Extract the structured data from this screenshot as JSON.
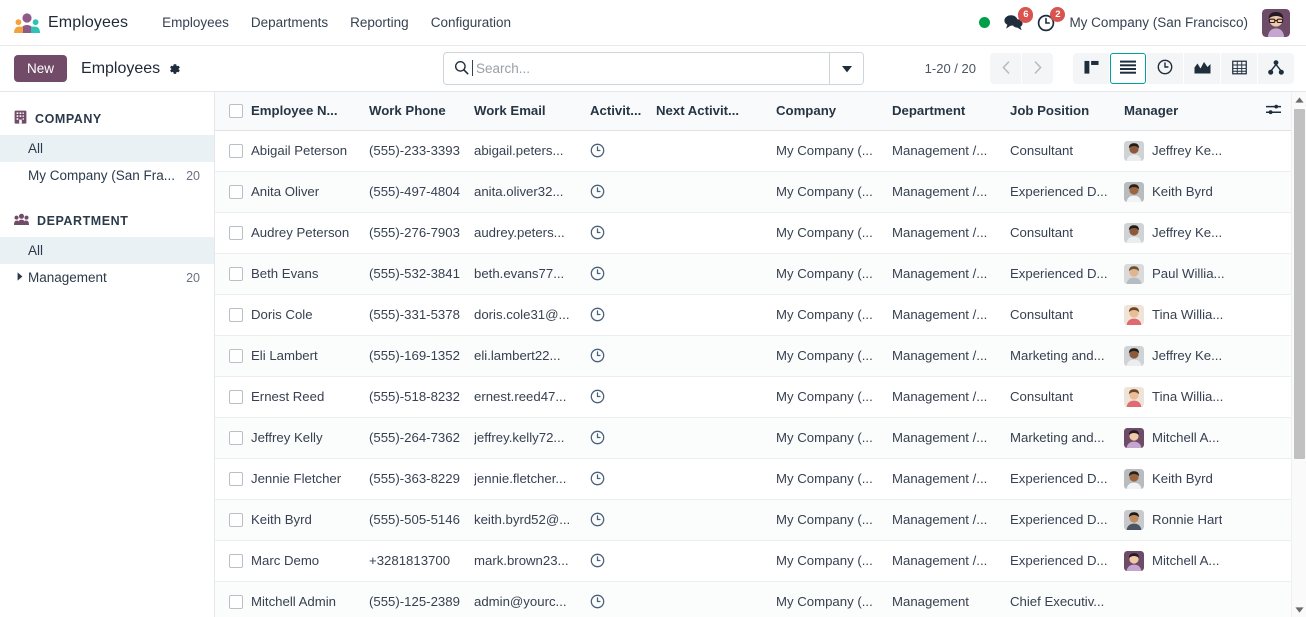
{
  "navbar": {
    "brand": "Employees",
    "brand_logo_icon": "employees-app-icon",
    "menu": [
      {
        "label": "Employees"
      },
      {
        "label": "Departments"
      },
      {
        "label": "Reporting"
      },
      {
        "label": "Configuration"
      }
    ],
    "presence_icon": "presence-dot-online",
    "presence_color": "#00A04A",
    "messages": {
      "icon": "chat-bubble-icon",
      "count": "6"
    },
    "activities": {
      "icon": "clock-icon",
      "count": "2"
    },
    "badge_color": "#D9534F",
    "company": "My Company (San Francisco)",
    "avatar_icon": "user-avatar"
  },
  "control": {
    "new_label": "New",
    "breadcrumb": "Employees",
    "gear_icon": "gear-icon",
    "accent_color": "#714B67",
    "search": {
      "icon": "search-icon",
      "placeholder": "Search...",
      "value": "",
      "toggle_icon": "chevron-down-icon"
    },
    "pager": {
      "range": "1-20 / 20",
      "prev_icon": "chevron-left-icon",
      "next_icon": "chevron-right-icon"
    },
    "views": [
      {
        "name": "kanban",
        "icon": "kanban-icon",
        "active": false
      },
      {
        "name": "list",
        "icon": "list-icon",
        "active": true
      },
      {
        "name": "activity",
        "icon": "activity-clock-icon",
        "active": false
      },
      {
        "name": "graph",
        "icon": "graph-icon",
        "active": false
      },
      {
        "name": "pivot",
        "icon": "pivot-table-icon",
        "active": false
      },
      {
        "name": "org-chart",
        "icon": "org-chart-icon",
        "active": false
      }
    ],
    "active_view_color": "#00A09D"
  },
  "sidebar": {
    "sections": [
      {
        "title": "COMPANY",
        "icon": "building-icon",
        "items": [
          {
            "label": "All",
            "count": "",
            "selected": true,
            "caret": false
          },
          {
            "label": "My Company (San Fra...",
            "count": "20",
            "selected": false,
            "caret": false
          }
        ]
      },
      {
        "title": "DEPARTMENT",
        "icon": "people-group-icon",
        "items": [
          {
            "label": "All",
            "count": "",
            "selected": true,
            "caret": false
          },
          {
            "label": "Management",
            "count": "20",
            "selected": false,
            "caret": true
          }
        ]
      }
    ]
  },
  "table": {
    "select_all_icon": "checkbox-unchecked",
    "optional_columns_icon": "column-options-icon",
    "columns": [
      "Employee N...",
      "Work Phone",
      "Work Email",
      "Activit...",
      "Next Activit...",
      "Company",
      "Department",
      "Job Position",
      "Manager"
    ],
    "rows": [
      {
        "name": "Abigail Peterson",
        "phone": "(555)-233-3393",
        "email": "abigail.peters...",
        "activity_icon": "clock-icon",
        "next_activity": "",
        "company": "My Company (...",
        "department": "Management /...",
        "job": "Consultant",
        "manager": "Jeffrey Ke...",
        "manager_avatar": "avatar-jeffrey"
      },
      {
        "name": "Anita Oliver",
        "phone": "(555)-497-4804",
        "email": "anita.oliver32...",
        "activity_icon": "clock-icon",
        "next_activity": "",
        "company": "My Company (...",
        "department": "Management /...",
        "job": "Experienced D...",
        "manager": "Keith Byrd",
        "manager_avatar": "avatar-keith"
      },
      {
        "name": "Audrey Peterson",
        "phone": "(555)-276-7903",
        "email": "audrey.peters...",
        "activity_icon": "clock-icon",
        "next_activity": "",
        "company": "My Company (...",
        "department": "Management /...",
        "job": "Consultant",
        "manager": "Jeffrey Ke...",
        "manager_avatar": "avatar-jeffrey"
      },
      {
        "name": "Beth Evans",
        "phone": "(555)-532-3841",
        "email": "beth.evans77...",
        "activity_icon": "clock-icon",
        "next_activity": "",
        "company": "My Company (...",
        "department": "Management /...",
        "job": "Experienced D...",
        "manager": "Paul Willia...",
        "manager_avatar": "avatar-paul"
      },
      {
        "name": "Doris Cole",
        "phone": "(555)-331-5378",
        "email": "doris.cole31@...",
        "activity_icon": "clock-icon",
        "next_activity": "",
        "company": "My Company (...",
        "department": "Management /...",
        "job": "Consultant",
        "manager": "Tina Willia...",
        "manager_avatar": "avatar-tina"
      },
      {
        "name": "Eli Lambert",
        "phone": "(555)-169-1352",
        "email": "eli.lambert22...",
        "activity_icon": "clock-icon",
        "next_activity": "",
        "company": "My Company (...",
        "department": "Management /...",
        "job": "Marketing and...",
        "manager": "Jeffrey Ke...",
        "manager_avatar": "avatar-jeffrey"
      },
      {
        "name": "Ernest Reed",
        "phone": "(555)-518-8232",
        "email": "ernest.reed47...",
        "activity_icon": "clock-icon",
        "next_activity": "",
        "company": "My Company (...",
        "department": "Management /...",
        "job": "Consultant",
        "manager": "Tina Willia...",
        "manager_avatar": "avatar-tina"
      },
      {
        "name": "Jeffrey Kelly",
        "phone": "(555)-264-7362",
        "email": "jeffrey.kelly72...",
        "activity_icon": "clock-icon",
        "next_activity": "",
        "company": "My Company (...",
        "department": "Management /...",
        "job": "Marketing and...",
        "manager": "Mitchell A...",
        "manager_avatar": "avatar-mitchell"
      },
      {
        "name": "Jennie Fletcher",
        "phone": "(555)-363-8229",
        "email": "jennie.fletcher...",
        "activity_icon": "clock-icon",
        "next_activity": "",
        "company": "My Company (...",
        "department": "Management /...",
        "job": "Experienced D...",
        "manager": "Keith Byrd",
        "manager_avatar": "avatar-keith"
      },
      {
        "name": "Keith Byrd",
        "phone": "(555)-505-5146",
        "email": "keith.byrd52@...",
        "activity_icon": "clock-icon",
        "next_activity": "",
        "company": "My Company (...",
        "department": "Management /...",
        "job": "Experienced D...",
        "manager": "Ronnie Hart",
        "manager_avatar": "avatar-ronnie"
      },
      {
        "name": "Marc Demo",
        "phone": "+3281813700",
        "email": "mark.brown23...",
        "activity_icon": "clock-icon",
        "next_activity": "",
        "company": "My Company (...",
        "department": "Management /...",
        "job": "Experienced D...",
        "manager": "Mitchell A...",
        "manager_avatar": "avatar-mitchell"
      },
      {
        "name": "Mitchell Admin",
        "phone": "(555)-125-2389",
        "email": "admin@yourc...",
        "activity_icon": "clock-icon",
        "next_activity": "",
        "company": "My Company (...",
        "department": "Management",
        "job": "Chief Executiv...",
        "manager": "",
        "manager_avatar": ""
      }
    ]
  },
  "scrollbar": {
    "up_icon": "triangle-up-icon",
    "down_icon": "triangle-down-icon"
  }
}
